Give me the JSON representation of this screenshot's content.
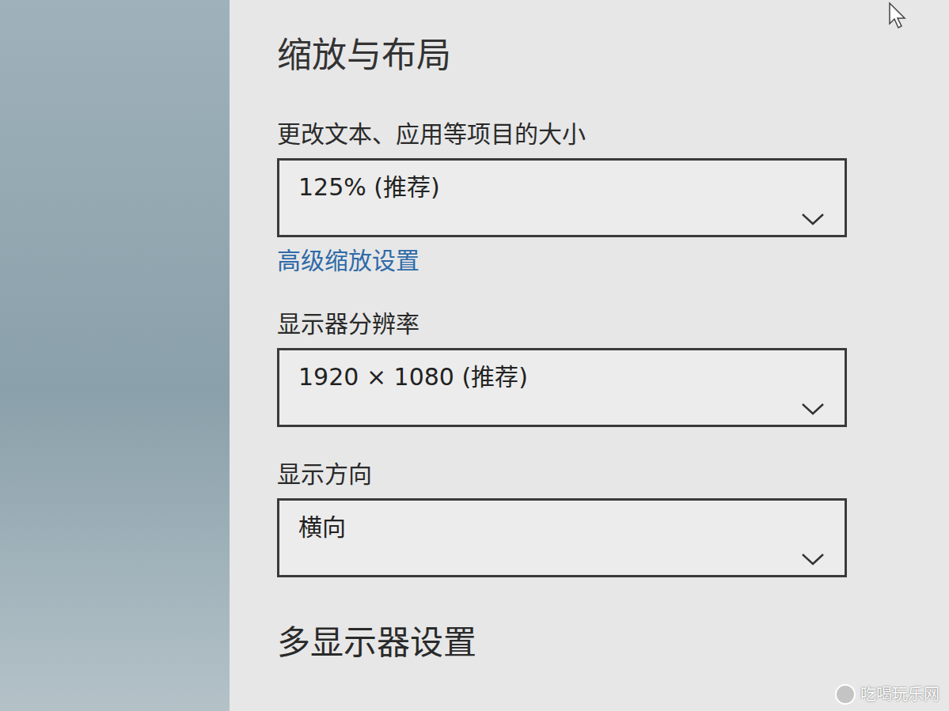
{
  "page": {
    "title": "缩放与布局"
  },
  "settings": [
    {
      "kind": "dropdown",
      "label": "更改文本、应用等项目的大小",
      "value": "125% (推荐)"
    },
    {
      "kind": "link",
      "text": "高级缩放设置"
    },
    {
      "kind": "dropdown",
      "label": "显示器分辨率",
      "value": "1920 × 1080 (推荐)"
    },
    {
      "kind": "dropdown",
      "label": "显示方向",
      "value": "横向"
    }
  ],
  "section_heading": "多显示器设置",
  "watermark": {
    "text": "吃喝玩乐网"
  }
}
